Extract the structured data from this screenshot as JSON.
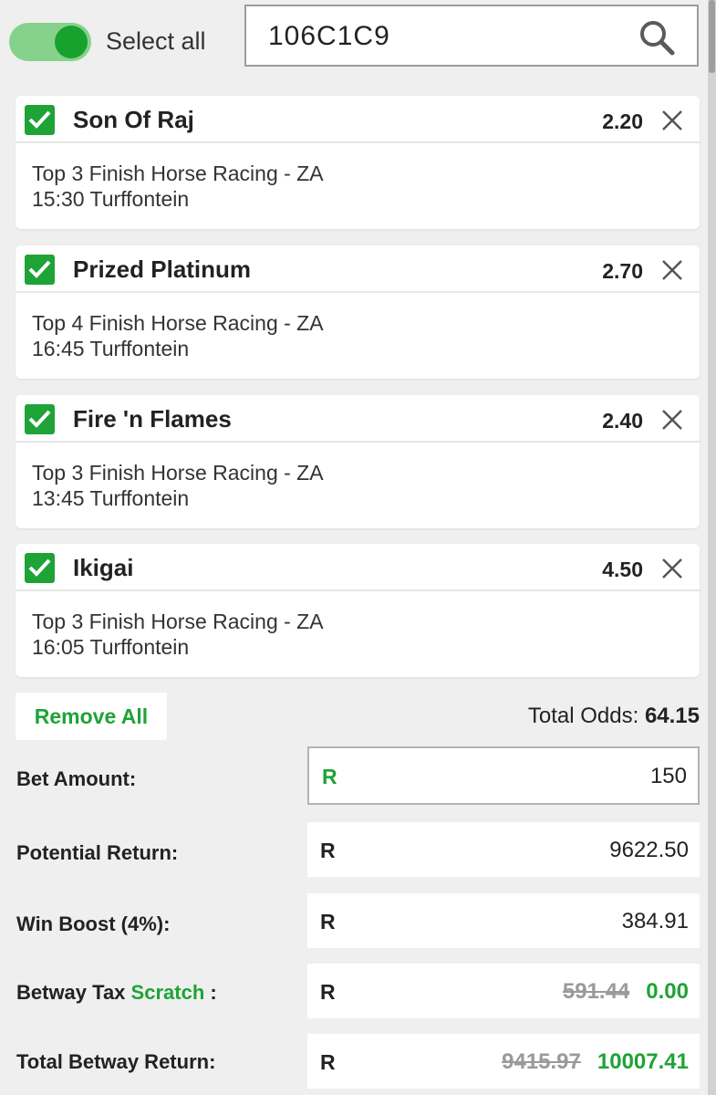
{
  "header": {
    "select_all_label": "Select all",
    "select_all_on": true,
    "search_value": "106C1C9"
  },
  "bets": [
    {
      "name": "Son Of Raj",
      "odds": "2.20",
      "market": "Top 3 Finish Horse Racing - ZA",
      "race": "15:30 Turffontein"
    },
    {
      "name": "Prized Platinum",
      "odds": "2.70",
      "market": "Top 4 Finish Horse Racing - ZA",
      "race": "16:45 Turffontein"
    },
    {
      "name": "Fire 'n Flames",
      "odds": "2.40",
      "market": "Top 3 Finish Horse Racing - ZA",
      "race": "13:45 Turffontein"
    },
    {
      "name": "Ikigai",
      "odds": "4.50",
      "market": "Top 3 Finish Horse Racing - ZA",
      "race": "16:05 Turffontein"
    }
  ],
  "summary": {
    "remove_all_label": "Remove All",
    "total_odds_label": "Total Odds:",
    "total_odds_value": "64.15"
  },
  "rows": {
    "currency": "R",
    "bet_amount_label": "Bet Amount:",
    "bet_amount_value": "150",
    "potential_return_label": "Potential Return:",
    "potential_return_value": "9622.50",
    "win_boost_label": "Win Boost (4%):",
    "win_boost_value": "384.91",
    "tax_label_prefix": "Betway Tax",
    "tax_label_scratch": "Scratch",
    "tax_label_suffix": ":",
    "tax_old_value": "591.44",
    "tax_new_value": "0.00",
    "total_return_label": "Total Betway Return:",
    "total_return_old_value": "9415.97",
    "total_return_new_value": "10007.41"
  },
  "colors": {
    "accent_green": "#1ea336",
    "toggle_track": "#86d28c",
    "background": "#efefef"
  },
  "icons": [
    "toggle-switch",
    "search-icon",
    "checkbox-checked-icon",
    "close-icon"
  ]
}
